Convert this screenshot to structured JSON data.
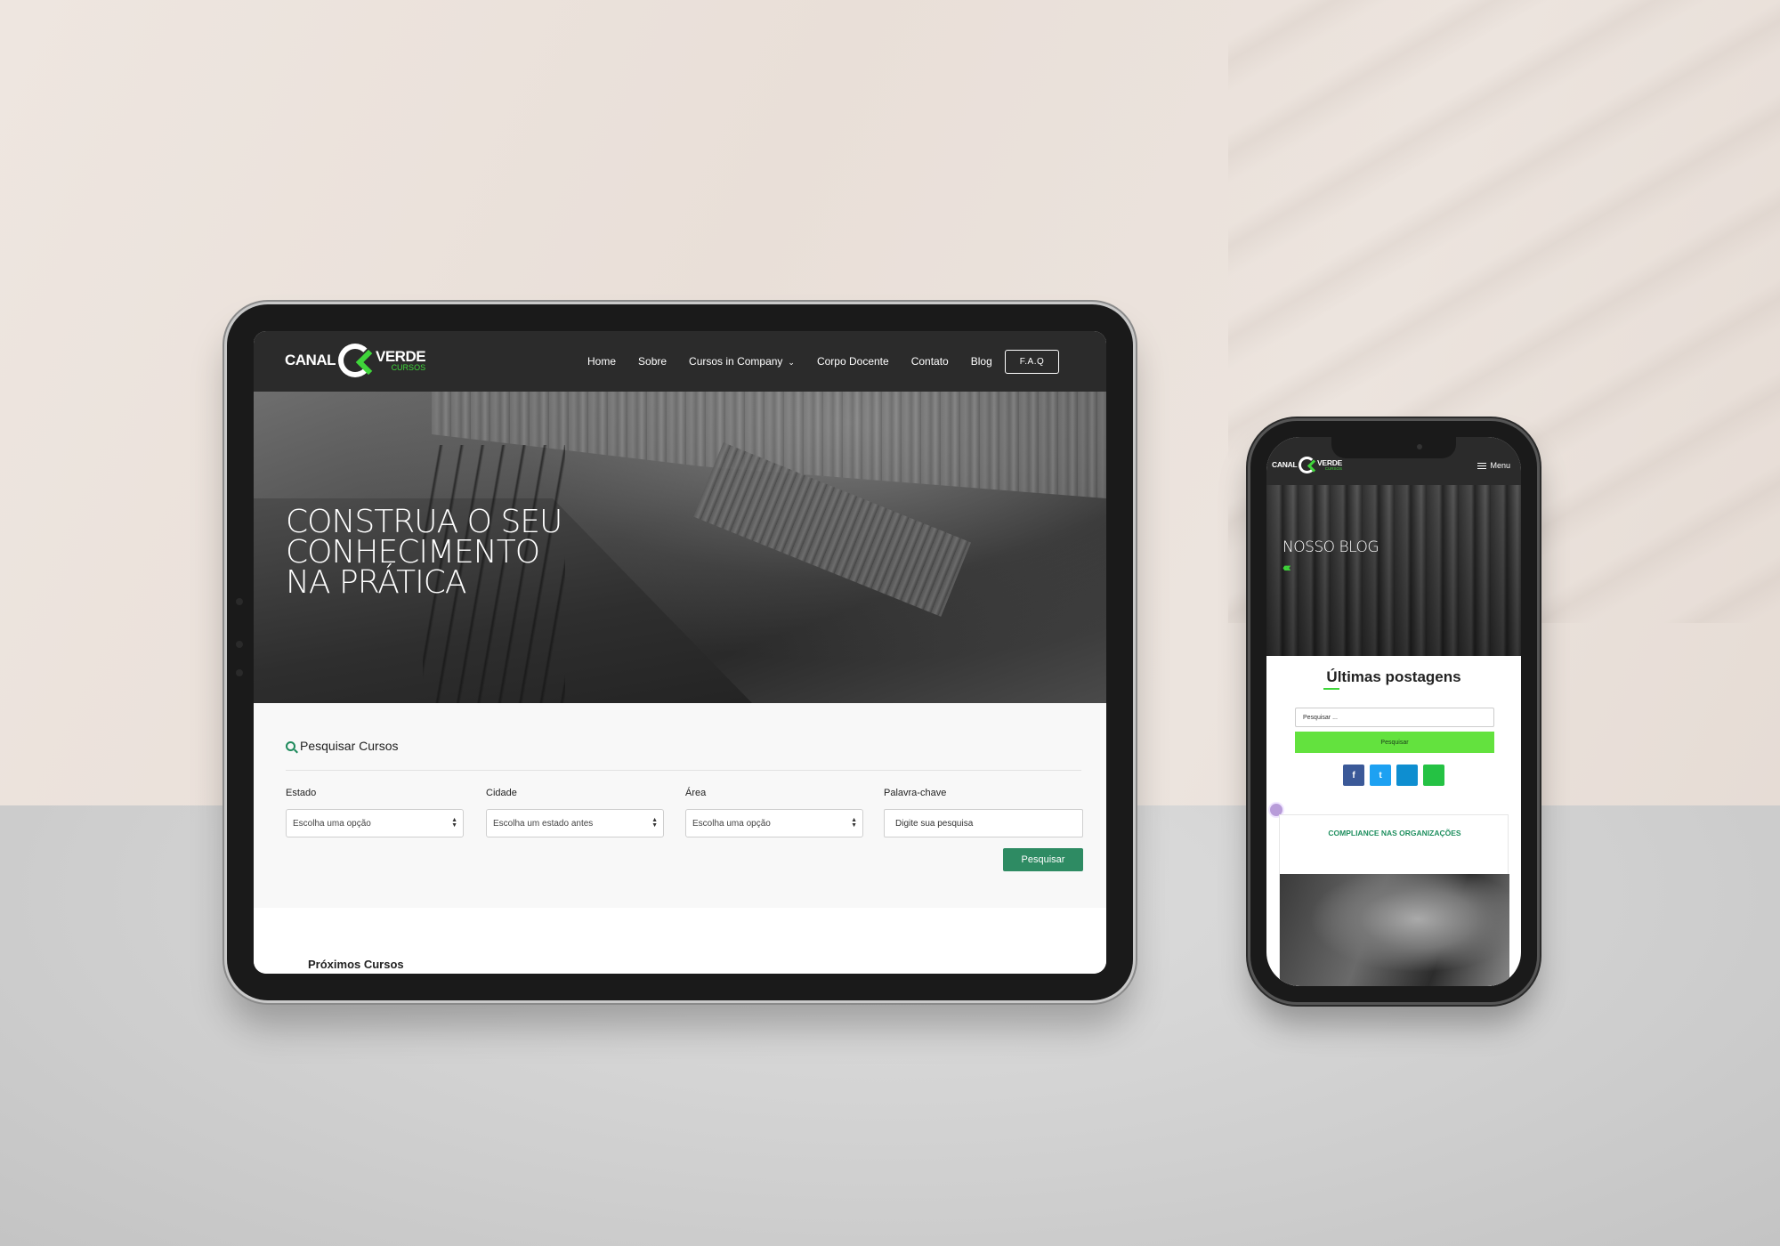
{
  "tablet": {
    "logo": {
      "canal": "CANAL",
      "verde": "VERDE",
      "cursos": "CURSOS"
    },
    "nav": {
      "items": [
        "Home",
        "Sobre",
        "Cursos in Company",
        "Corpo Docente",
        "Contato",
        "Blog"
      ],
      "faq": "F.A.Q"
    },
    "hero": {
      "headline_lines": [
        "CONSTRUA O SEU",
        "CONHECIMENTO",
        "NA PRÁTICA"
      ]
    },
    "search": {
      "title": "Pesquisar Cursos",
      "fields": [
        {
          "label": "Estado",
          "value": "Escolha uma opção"
        },
        {
          "label": "Cidade",
          "value": "Escolha um estado antes"
        },
        {
          "label": "Área",
          "value": "Escolha uma opção"
        },
        {
          "label": "Palavra-chave",
          "placeholder": "Digite sua pesquisa"
        }
      ],
      "button": "Pesquisar"
    },
    "next_courses": "Próximos Cursos"
  },
  "phone": {
    "menu_label": "Menu",
    "hero_title": "NOSSO BLOG",
    "hero_chevrons": "‹‹‹‹",
    "section_title": "Últimas postagens",
    "search_placeholder": "Pesquisar ...",
    "search_button": "Pesquisar",
    "social": [
      "f",
      "t",
      "in",
      "w"
    ],
    "card_title": "COMPLIANCE NAS ORGANIZAÇÕES"
  },
  "colors": {
    "brand_green": "#3fd53a",
    "button_green": "#2e8b63",
    "phone_button_green": "#63e23e",
    "nav_dark": "#2b2b2b"
  }
}
